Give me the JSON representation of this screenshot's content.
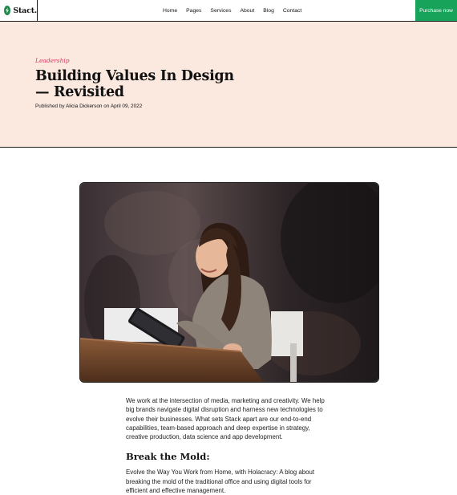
{
  "brand": {
    "name": "Stact."
  },
  "nav": [
    {
      "label": "Home"
    },
    {
      "label": "Pages"
    },
    {
      "label": "Services"
    },
    {
      "label": "About"
    },
    {
      "label": "Blog"
    },
    {
      "label": "Contact"
    }
  ],
  "cta": {
    "label": "Purchase now"
  },
  "colors": {
    "accent": "#17a35a",
    "hero_bg": "#fbe8df",
    "category": "#d9385a"
  },
  "post": {
    "category": "Leadership",
    "title": "Building Values In Design — Revisited",
    "published_prefix": "Published by",
    "author": "Alicia Dickerson",
    "on": "on",
    "date": "April 09, 2022",
    "intro": "We work at the intersection of media, marketing and creativity. We help big brands navigate digital disruption and harness new technologies to evolve their businesses. What sets Stack apart are our end-to-end capabilities, team-based approach and deep expertise in strategy, creative production, data science and app development.",
    "subheading": "Break the Mold:",
    "body": "Evolve the Way You Work from Home, with Holacracy: A blog about breaking the mold of the traditional office and using digital tools for efficient and effective management."
  }
}
